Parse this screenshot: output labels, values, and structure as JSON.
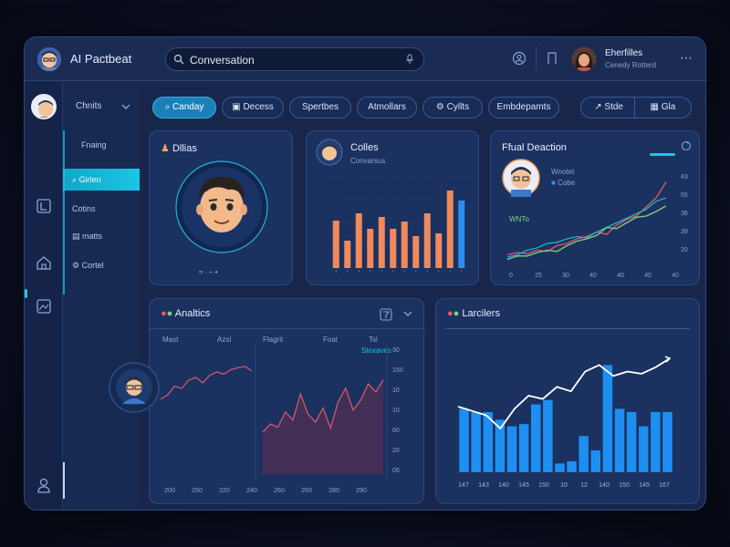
{
  "app": {
    "title": "AI Pactbeat",
    "search": {
      "value": "Conversation",
      "placeholder": "Conversation"
    },
    "user": {
      "name": "Eherfilles",
      "subtitle": "Cenedy Rotterd"
    },
    "more": "⋯"
  },
  "nav": {
    "header": "Chnits",
    "items": [
      {
        "label": "Fnaing"
      },
      {
        "label": "Girlen"
      },
      {
        "label": "Cotins"
      },
      {
        "label": "matts"
      },
      {
        "label": "Cortel"
      }
    ]
  },
  "tabs": [
    {
      "label": "Canday"
    },
    {
      "label": "Decess"
    },
    {
      "label": "Spertbes"
    },
    {
      "label": "Atmollars"
    },
    {
      "label": "Cyllts"
    },
    {
      "label": "Embdepamts"
    }
  ],
  "toolbar": {
    "site_label": "Stde",
    "view_label": "Gla"
  },
  "cards": {
    "profile": {
      "title": "Dllias",
      "footer": "≈ ∙ – •"
    },
    "colles": {
      "title": "Colles",
      "subtitle": "Convarsus"
    },
    "detection": {
      "title": "Ffual Deaction",
      "legend_1": "Wnotet",
      "legend_2": "Cobe",
      "left_label": "WNTo",
      "y_ticks": [
        "43",
        "55",
        "36",
        "39",
        "20"
      ],
      "x_ticks": [
        "0",
        "25",
        "30",
        "40",
        "40",
        "40",
        "40"
      ]
    },
    "analytics": {
      "title": "Analtics",
      "col_1": "Mast",
      "col_2": "Azsl",
      "col_3": "Flagrit",
      "col_4": "Foat",
      "col_5": "Tsl",
      "badge": "Stoxaves",
      "y_ticks": [
        "30",
        "150",
        "10",
        "10",
        "60",
        "20",
        "05"
      ],
      "x_ticks": [
        "200",
        "250",
        "220",
        "240",
        "260",
        "260",
        "280",
        "290"
      ]
    },
    "larchers": {
      "title": "Larcilers",
      "x_ticks": [
        "147",
        "143",
        "140",
        "145",
        "150",
        "10",
        "12",
        "140",
        "150",
        "145",
        "167"
      ]
    }
  },
  "chart_data": [
    {
      "type": "bar",
      "title": "Colles",
      "values": [
        52,
        30,
        60,
        43,
        56,
        43,
        51,
        35,
        60,
        38,
        85,
        74
      ],
      "colors": [
        "#f08a5d",
        "#f08a5d",
        "#f08a5d",
        "#f08a5d",
        "#f08a5d",
        "#f08a5d",
        "#f08a5d",
        "#f08a5d",
        "#f08a5d",
        "#f08a5d",
        "#f08a5d",
        "#2c8ff0"
      ],
      "ylim": [
        0,
        100
      ]
    },
    {
      "type": "line",
      "title": "Ffual Deaction",
      "series": [
        {
          "name": "Cobe",
          "color": "#e05c63",
          "values": [
            10,
            12,
            11,
            14,
            13,
            18,
            20,
            24,
            26,
            30,
            28,
            36,
            41,
            44,
            52,
            60,
            74
          ]
        },
        {
          "name": "Wnotet",
          "color": "#1fb2c8",
          "values": [
            8,
            10,
            14,
            16,
            20,
            21,
            24,
            26,
            25,
            30,
            34,
            38,
            42,
            46,
            50,
            57,
            60
          ]
        },
        {
          "name": "",
          "color": "#7ed37a",
          "values": [
            6,
            9,
            9,
            12,
            14,
            13,
            18,
            22,
            24,
            27,
            34,
            33,
            38,
            43,
            44,
            48,
            53
          ]
        }
      ],
      "ylim": [
        0,
        80
      ]
    },
    {
      "type": "line",
      "title": "Analtics",
      "series": [
        {
          "name": "left",
          "color": "#d0596a",
          "values": [
            20,
            28,
            44,
            40,
            55,
            60,
            50,
            64,
            70,
            66,
            74,
            78,
            80,
            72
          ]
        },
        {
          "name": "right",
          "color": "#d0596a",
          "fill": "#4a2f55",
          "values": [
            40,
            48,
            45,
            60,
            52,
            78,
            58,
            50,
            64,
            44,
            70,
            84,
            62,
            72,
            88,
            80,
            92
          ]
        }
      ],
      "ylim": [
        0,
        100
      ]
    },
    {
      "type": "bar",
      "title": "Larcilers",
      "values": [
        58,
        55,
        55,
        48,
        42,
        44,
        62,
        66,
        8,
        10,
        33,
        20,
        98,
        58,
        55,
        42,
        55,
        55
      ],
      "line": [
        60,
        56,
        52,
        40,
        58,
        70,
        67,
        78,
        74,
        92,
        98,
        88,
        92,
        90,
        96,
        104
      ],
      "color": "#1e8ff0",
      "ylim": [
        0,
        120
      ]
    }
  ],
  "colors": {
    "accent": "#1cc6e4",
    "bar_orange": "#f08a5d",
    "bar_blue": "#1e8ff0",
    "panel": "#1b3160"
  }
}
